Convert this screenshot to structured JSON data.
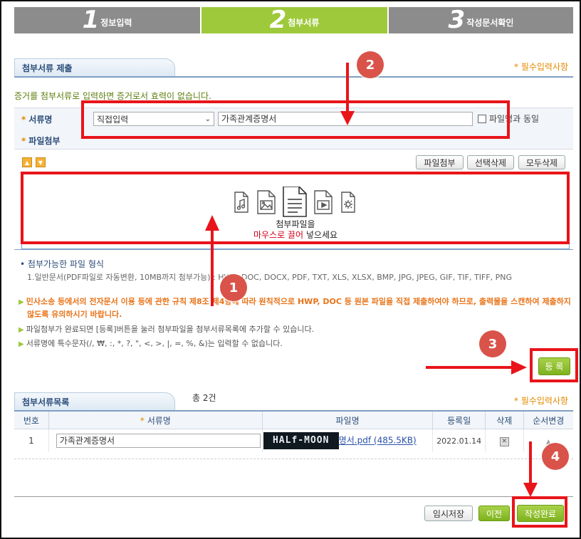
{
  "steps": [
    {
      "num": "1",
      "label": "정보입력"
    },
    {
      "num": "2",
      "label": "첨부서류"
    },
    {
      "num": "3",
      "label": "작성문서확인"
    }
  ],
  "submit_section": {
    "title": "첨부서류 제출",
    "required_note": "* 필수입력사항",
    "notice": "증거를 첨부서류로 입력하면 증거로서 효력이 없습니다.",
    "doc_name_label": "서류명",
    "doc_type_selected": "직접입력",
    "doc_name_value": "가족관계증명서",
    "same_as_filename_label": "파일명과 동일",
    "file_attach_label": "파일첨부",
    "buttons": {
      "attach": "파일첨부",
      "delete_selected": "선택삭제",
      "delete_all": "모두삭제"
    },
    "drop_line1": "첨부파일을",
    "drop_line2_red": "마우스로 끌어",
    "drop_line2_rest": "넣으세요",
    "formats_title": "첨부가능한 파일 형식",
    "formats_text": "1.일반문서(PDF파일로 자동변환, 10MB까지 첨부가능) : HWP, DOC, DOCX, PDF, TXT, XLS, XLSX, BMP, JPG, JPEG, GIF, TIF, TIFF, PNG",
    "warning": "민사소송 등에서의 전자문서 이용 등에 관한 규칙 제8조 제4항에 따라 원칙적으로 HWP, DOC 등 원본 파일을 직접 제출하여야 하므로, 출력물을 스캔하여 제출하지 않도록 유의하시기 바랍니다.",
    "info1": "파일첨부가 완료되면 [등록]버튼을 눌러 첨부파일을 첨부서류목록에 추가할 수 있습니다.",
    "info2": "서류명에 특수문자(/, ₩, :, *, ?, \", <, >, |, =, %, &)는 입력할 수 없습니다.",
    "register_button": "등 록"
  },
  "list_section": {
    "title": "첨부서류목록",
    "count": "총 2건",
    "required_note": "* 필수입력사항",
    "columns": [
      "번호",
      "서류명",
      "파일명",
      "등록일",
      "삭제",
      "순서변경"
    ],
    "rows": [
      {
        "no": "1",
        "doc_name": "가족관계증명서",
        "file_name": "명서.pdf (485.5KB)",
        "date": "2022.01.14"
      }
    ],
    "watermark": "HALf-MOON"
  },
  "footer_buttons": {
    "temp_save": "임시저장",
    "prev": "이전",
    "complete": "작성완료"
  },
  "callouts": [
    "1",
    "2",
    "3",
    "4"
  ],
  "colors": {
    "green": "#9ec93b",
    "gray": "#8c8c8c",
    "red": "#e8141a",
    "orange": "#e28a00"
  }
}
